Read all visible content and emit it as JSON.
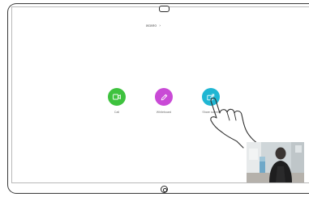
{
  "header": {
    "device_name": "acano"
  },
  "actions": [
    {
      "label": "Call",
      "icon": "camera-icon",
      "color": "#3ec23e"
    },
    {
      "label": "Whiteboard",
      "icon": "pencil-icon",
      "color": "#c94ad6"
    },
    {
      "label": "Share screen",
      "icon": "share-screen-icon",
      "color": "#1fb6d3"
    }
  ],
  "self_view": {
    "icon": "self-view-video"
  }
}
